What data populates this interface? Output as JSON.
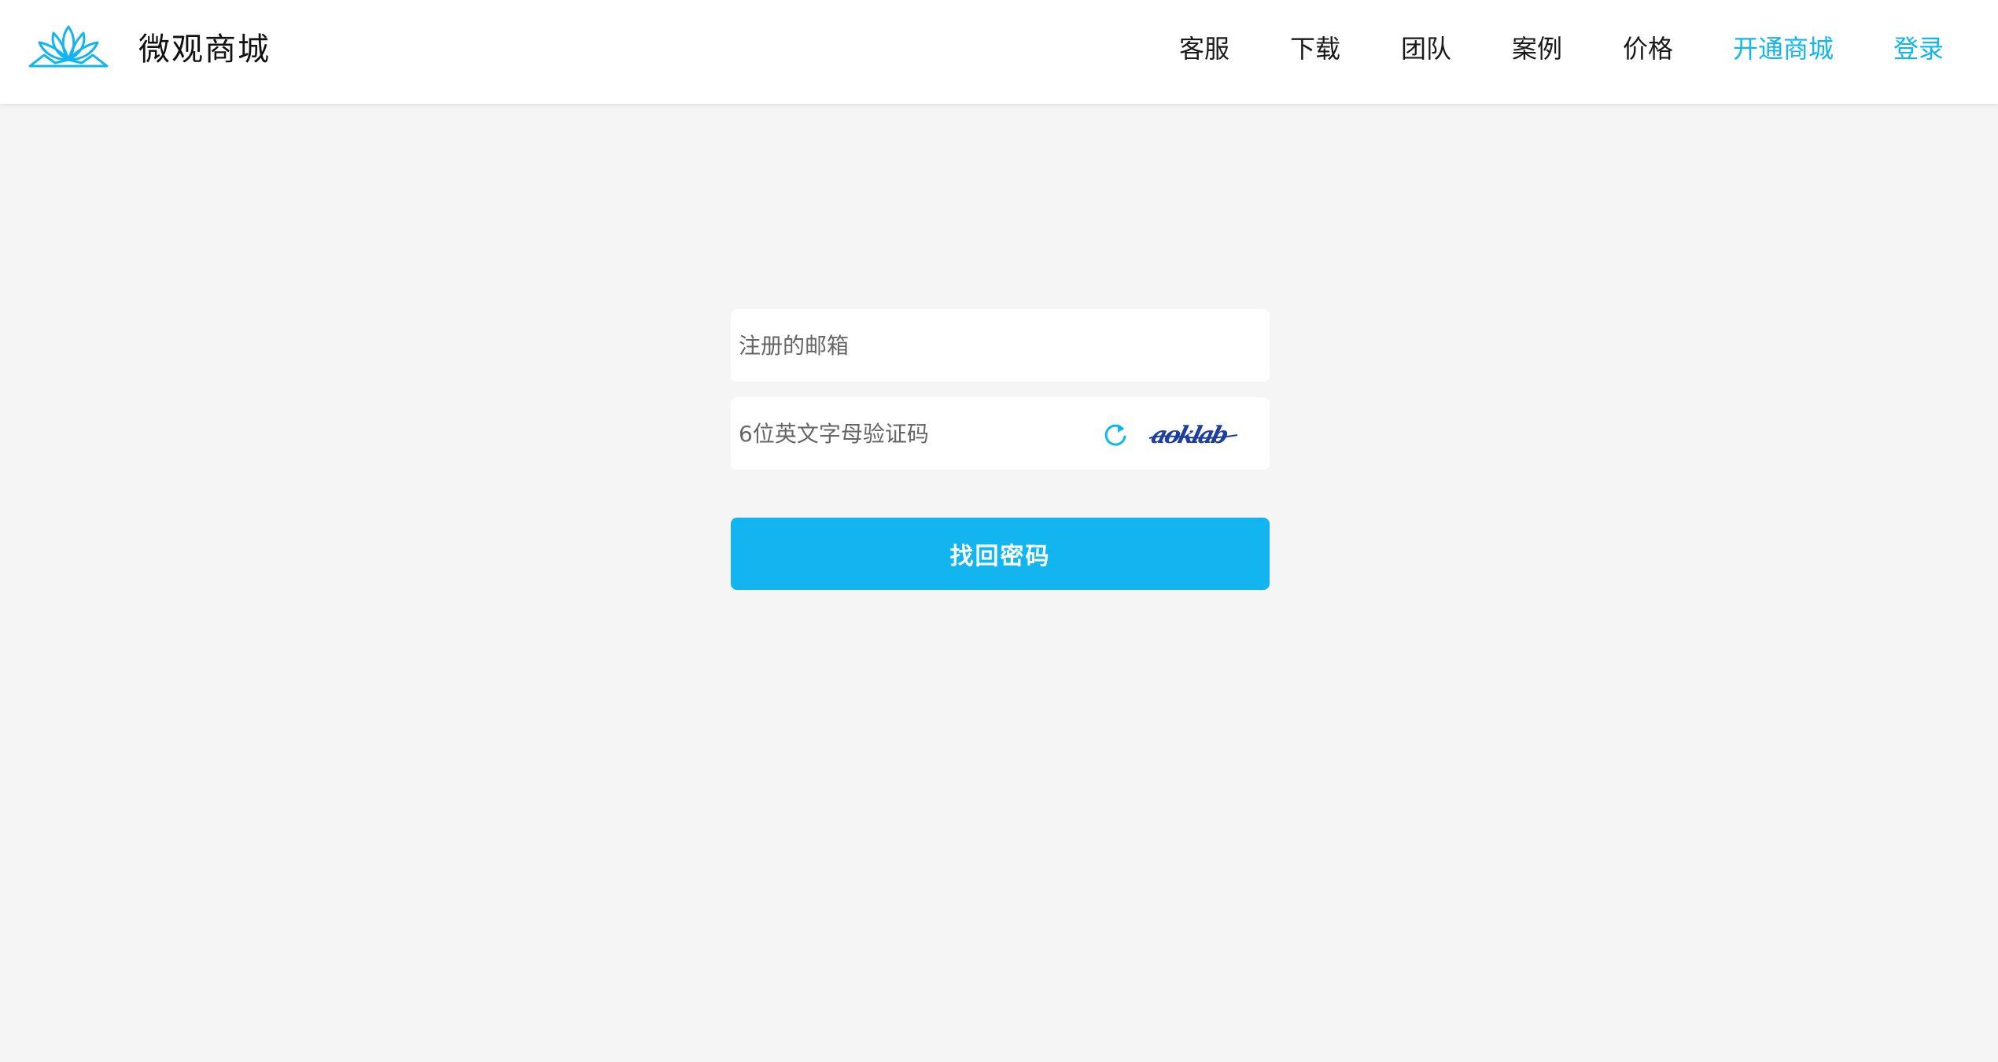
{
  "header": {
    "brand": "微观商城",
    "logo_icon": "lotus-logo-icon",
    "nav": [
      {
        "label": "客服"
      },
      {
        "label": "下载"
      },
      {
        "label": "团队"
      },
      {
        "label": "案例"
      },
      {
        "label": "价格"
      },
      {
        "label": "开通商城"
      },
      {
        "label": "登录"
      }
    ]
  },
  "form": {
    "email_placeholder": "注册的邮箱",
    "captcha_placeholder": "6位英文字母验证码",
    "refresh_icon": "refresh-icon",
    "captcha_text": "aoklab",
    "submit_label": "找回密码"
  },
  "colors": {
    "accent": "#12b5ef",
    "background": "#f5f5f5",
    "text": "#1a1a1a",
    "captcha": "#1f3f9e"
  }
}
